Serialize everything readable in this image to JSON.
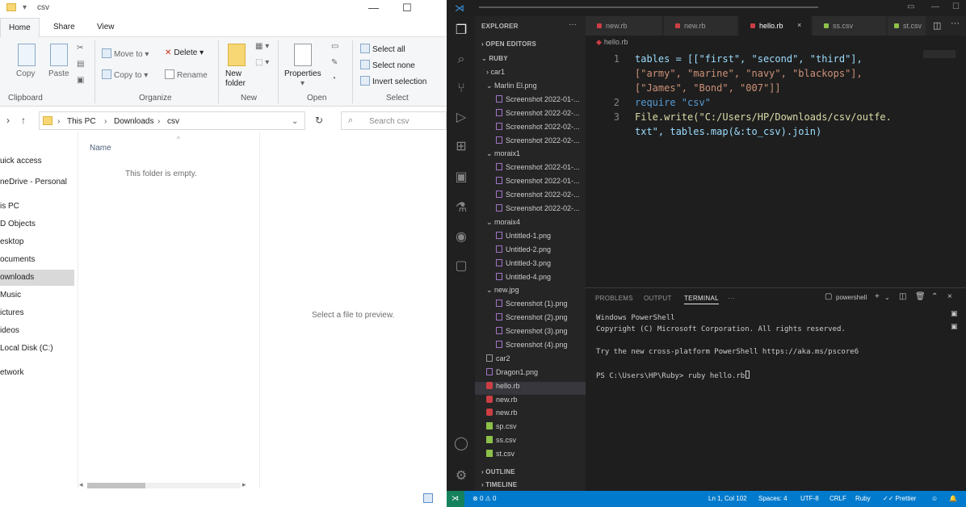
{
  "explorer": {
    "title": "csv",
    "tabs": [
      "Home",
      "Share",
      "View"
    ],
    "ribbon": {
      "clipboard": {
        "copy": "Copy",
        "paste": "Paste",
        "label": "Clipboard"
      },
      "organize": {
        "move_to": "Move to",
        "copy_to": "Copy to",
        "delete": "Delete",
        "rename": "Rename",
        "label": "Organize"
      },
      "new": {
        "new_folder": "New folder",
        "label": "New"
      },
      "open": {
        "properties": "Properties",
        "label": "Open"
      },
      "select": {
        "select_all": "Select all",
        "select_none": "Select none",
        "invert_selection": "Invert selection",
        "label": "Select"
      }
    },
    "address": {
      "crumbs": [
        "This PC",
        "Downloads",
        "csv"
      ],
      "search_placeholder": "Search csv"
    },
    "nav_items": [
      "uick access",
      "neDrive - Personal",
      "is PC",
      "D Objects",
      "esktop",
      "ocuments",
      "ownloads",
      "Music",
      "ictures",
      "ideos",
      "Local Disk (C:)",
      "etwork"
    ],
    "selected_nav": "ownloads",
    "column_name": "Name",
    "empty_message": "This folder is empty.",
    "preview_message": "Select a file to preview."
  },
  "vscode": {
    "sidebar": {
      "header": "EXPLORER",
      "open_editors": "OPEN EDITORS",
      "root": "RUBY",
      "tree": [
        {
          "label": "car1",
          "indent": 0,
          "type": "folder-closed"
        },
        {
          "label": "Marlin El.png",
          "indent": 0,
          "type": "folder-open"
        },
        {
          "label": "Screenshot 2022-01-...",
          "indent": 1,
          "type": "img"
        },
        {
          "label": "Screenshot 2022-02-...",
          "indent": 1,
          "type": "img"
        },
        {
          "label": "Screenshot 2022-02-...",
          "indent": 1,
          "type": "img"
        },
        {
          "label": "Screenshot 2022-02-...",
          "indent": 1,
          "type": "img"
        },
        {
          "label": "moraix1",
          "indent": 0,
          "type": "folder-open"
        },
        {
          "label": "Screenshot 2022-01-...",
          "indent": 1,
          "type": "img"
        },
        {
          "label": "Screenshot 2022-01-...",
          "indent": 1,
          "type": "img"
        },
        {
          "label": "Screenshot 2022-02-...",
          "indent": 1,
          "type": "img"
        },
        {
          "label": "Screenshot 2022-02-...",
          "indent": 1,
          "type": "img"
        },
        {
          "label": "moraix4",
          "indent": 0,
          "type": "folder-open"
        },
        {
          "label": "Untitled-1.png",
          "indent": 1,
          "type": "img"
        },
        {
          "label": "Untitled-2.png",
          "indent": 1,
          "type": "img"
        },
        {
          "label": "Untitled-3.png",
          "indent": 1,
          "type": "img"
        },
        {
          "label": "Untitled-4.png",
          "indent": 1,
          "type": "img"
        },
        {
          "label": "new.jpg",
          "indent": 0,
          "type": "folder-open"
        },
        {
          "label": "Screenshot (1).png",
          "indent": 1,
          "type": "img"
        },
        {
          "label": "Screenshot (2).png",
          "indent": 1,
          "type": "img"
        },
        {
          "label": "Screenshot (3).png",
          "indent": 1,
          "type": "img"
        },
        {
          "label": "Screenshot (4).png",
          "indent": 1,
          "type": "img"
        },
        {
          "label": "car2",
          "indent": -1,
          "type": "txt"
        },
        {
          "label": "Dragon1.png",
          "indent": -1,
          "type": "img"
        },
        {
          "label": "hello.rb",
          "indent": -1,
          "type": "rb",
          "selected": true
        },
        {
          "label": "new.rb",
          "indent": -1,
          "type": "rb"
        },
        {
          "label": "new.rb",
          "indent": -1,
          "type": "rb"
        },
        {
          "label": "sp.csv",
          "indent": -1,
          "type": "csv"
        },
        {
          "label": "ss.csv",
          "indent": -1,
          "type": "csv"
        },
        {
          "label": "st.csv",
          "indent": -1,
          "type": "csv"
        }
      ],
      "outline": "OUTLINE",
      "timeline": "TIMELINE"
    },
    "tabs": [
      {
        "label": "new.rb",
        "kind": "rb",
        "active": false
      },
      {
        "label": "new.rb",
        "kind": "rb",
        "active": false
      },
      {
        "label": "hello.rb",
        "kind": "rb",
        "active": true
      },
      {
        "label": "ss.csv",
        "kind": "csv",
        "active": false
      },
      {
        "label": "st.csv",
        "kind": "csv",
        "active": false
      }
    ],
    "breadcrumb": "hello.rb",
    "code": {
      "line_numbers": [
        "1",
        "2",
        "3"
      ],
      "lines": [
        "tables = [[\"first\", \"second\", \"third\"],",
        "[\"army\", \"marine\", \"navy\", \"blackops\"],",
        "[\"James\", \"Bond\", \"007\"]]",
        "require \"csv\"",
        "File.write(\"C:/Users/HP/Downloads/csv/outfe.",
        "txt\", tables.map(&:to_csv).join)"
      ]
    },
    "panel": {
      "tabs": [
        "PROBLEMS",
        "OUTPUT",
        "TERMINAL"
      ],
      "active_tab": "TERMINAL",
      "shell": "powershell",
      "terminal_lines": [
        "Windows PowerShell",
        "Copyright (C) Microsoft Corporation. All rights reserved.",
        "",
        "Try the new cross-platform PowerShell https://aka.ms/pscore6",
        "",
        "PS C:\\Users\\HP\\Ruby> ruby hello.rb"
      ]
    },
    "status": {
      "errors": "0",
      "warnings": "0",
      "position": "Ln 1, Col 102",
      "spaces": "Spaces: 4",
      "encoding": "UTF-8",
      "eol": "CRLF",
      "language": "Ruby",
      "formatter": "Prettier"
    }
  }
}
